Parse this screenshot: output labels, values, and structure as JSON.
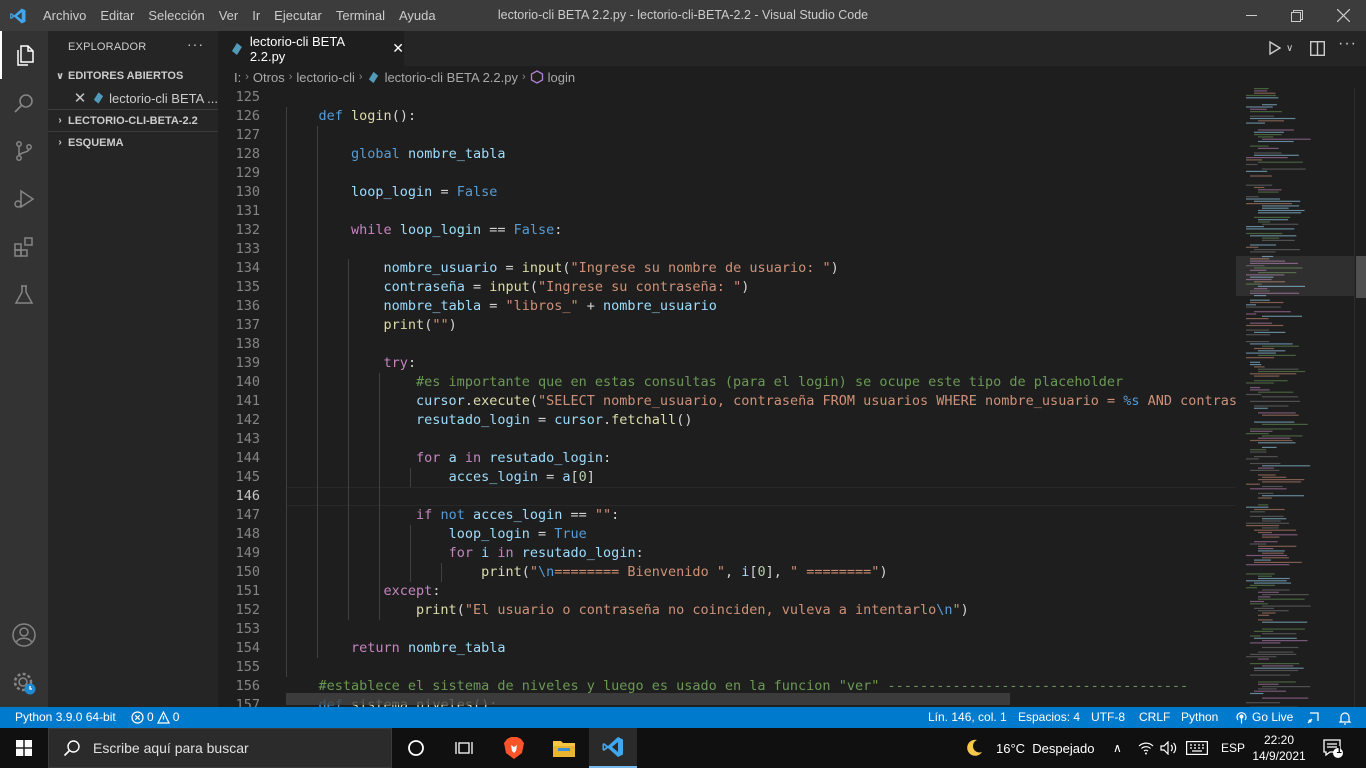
{
  "window": {
    "menu": [
      "Archivo",
      "Editar",
      "Selección",
      "Ver",
      "Ir",
      "Ejecutar",
      "Terminal",
      "Ayuda"
    ],
    "title": "lectorio-cli BETA 2.2.py - lectorio-cli-BETA-2.2 - Visual Studio Code"
  },
  "sidebar": {
    "title": "EXPLORADOR",
    "more": "···",
    "open_editors": "EDITORES ABIERTOS",
    "open_file": "lectorio-cli BETA ...",
    "folder": "LECTORIO-CLI-BETA-2.2",
    "outline": "ESQUEMA"
  },
  "tab": {
    "label": "lectorio-cli BETA 2.2.py"
  },
  "breadcrumb": [
    "I:",
    "Otros",
    "lectorio-cli",
    "lectorio-cli BETA 2.2.py",
    "login"
  ],
  "editor": {
    "current_line": 146,
    "lines": [
      {
        "n": "125",
        "code": ""
      },
      {
        "n": "126",
        "code": "    <span class=\"df\">def</span> <span class=\"fn\">login</span>():"
      },
      {
        "n": "127",
        "code": ""
      },
      {
        "n": "128",
        "code": "        <span class=\"df\">global</span> <span class=\"vr\">nombre_tabla</span>"
      },
      {
        "n": "129",
        "code": ""
      },
      {
        "n": "130",
        "code": "        <span class=\"vr\">loop_login</span> = <span class=\"cn\">False</span>"
      },
      {
        "n": "131",
        "code": ""
      },
      {
        "n": "132",
        "code": "        <span class=\"kw\">while</span> <span class=\"vr\">loop_login</span> == <span class=\"cn\">False</span>:"
      },
      {
        "n": "133",
        "code": ""
      },
      {
        "n": "134",
        "code": "            <span class=\"vr\">nombre_usuario</span> = <span class=\"fn\">input</span>(<span class=\"st\">\"Ingrese su nombre de usuario: \"</span>)"
      },
      {
        "n": "135",
        "code": "            <span class=\"vr\">contraseña</span> = <span class=\"fn\">input</span>(<span class=\"st\">\"Ingrese su contraseña: \"</span>)"
      },
      {
        "n": "136",
        "code": "            <span class=\"vr\">nombre_tabla</span> = <span class=\"st\">\"libros_\"</span> + <span class=\"vr\">nombre_usuario</span>"
      },
      {
        "n": "137",
        "code": "            <span class=\"fn\">print</span>(<span class=\"st\">\"\"</span>)"
      },
      {
        "n": "138",
        "code": ""
      },
      {
        "n": "139",
        "code": "            <span class=\"kw\">try</span>:"
      },
      {
        "n": "140",
        "code": "                <span class=\"cm\">#es importante que en estas consultas (para el login) se ocupe este tipo de placeholder</span>"
      },
      {
        "n": "141",
        "code": "                <span class=\"vr\">cursor</span>.<span class=\"fn\">execute</span>(<span class=\"st\">\"SELECT nombre_usuario, contraseña FROM usuarios WHERE nombre_usuario = </span><span class=\"df\">%s</span><span class=\"st\"> AND contraseña = </span>"
      },
      {
        "n": "142",
        "code": "                <span class=\"vr\">resutado_login</span> = <span class=\"vr\">cursor</span>.<span class=\"fn\">fetchall</span>()"
      },
      {
        "n": "143",
        "code": ""
      },
      {
        "n": "144",
        "code": "                <span class=\"kw\">for</span> <span class=\"vr\">a</span> <span class=\"kw\">in</span> <span class=\"vr\">resutado_login</span>:"
      },
      {
        "n": "145",
        "code": "                    <span class=\"vr\">acces_login</span> = <span class=\"vr\">a</span>[<span class=\"nm\">0</span>]"
      },
      {
        "n": "146",
        "code": ""
      },
      {
        "n": "147",
        "code": "                <span class=\"kw\">if</span> <span class=\"df\">not</span> <span class=\"vr\">acces_login</span> == <span class=\"st\">\"\"</span>:"
      },
      {
        "n": "148",
        "code": "                    <span class=\"vr\">loop_login</span> = <span class=\"cn\">True</span>"
      },
      {
        "n": "149",
        "code": "                    <span class=\"kw\">for</span> <span class=\"vr\">i</span> <span class=\"kw\">in</span> <span class=\"vr\">resutado_login</span>:"
      },
      {
        "n": "150",
        "code": "                        <span class=\"fn\">print</span>(<span class=\"st\">\"</span><span class=\"df\">\\n</span><span class=\"st\">======== Bienvenido \"</span>, <span class=\"vr\">i</span>[<span class=\"nm\">0</span>], <span class=\"st\">\" ========\"</span>)"
      },
      {
        "n": "151",
        "code": "            <span class=\"kw\">except</span>:"
      },
      {
        "n": "152",
        "code": "                <span class=\"fn\">print</span>(<span class=\"st\">\"El usuario o contraseña no coinciden, vuleva a intentarlo</span><span class=\"df\">\\n</span><span class=\"st\">\"</span>)"
      },
      {
        "n": "153",
        "code": ""
      },
      {
        "n": "154",
        "code": "        <span class=\"kw\">return</span> <span class=\"vr\">nombre_tabla</span>"
      },
      {
        "n": "155",
        "code": ""
      },
      {
        "n": "156",
        "code": "    <span class=\"cm\">#establece el sistema de niveles y luego es usado en la funcion \"ver\" -------------------------------------</span>"
      },
      {
        "n": "157",
        "code": "    <span class=\"df\">def</span> <span class=\"fn\">sistema_niveles</span>():"
      }
    ]
  },
  "status": {
    "python": "Python 3.9.0 64-bit",
    "errors": "0",
    "warnings": "0",
    "position": "Lín. 146, col. 1",
    "spaces": "Espacios: 4",
    "encoding": "UTF-8",
    "eol": "CRLF",
    "language": "Python",
    "golive": "Go Live"
  },
  "taskbar": {
    "search_placeholder": "Escribe aquí para buscar",
    "weather": "16°C  Despejado",
    "lang": "ESP",
    "time": "22:20",
    "date": "14/9/2021",
    "notifications": "1"
  },
  "colors": {
    "accent": "#007acc",
    "editor_bg": "#1e1e1e"
  }
}
